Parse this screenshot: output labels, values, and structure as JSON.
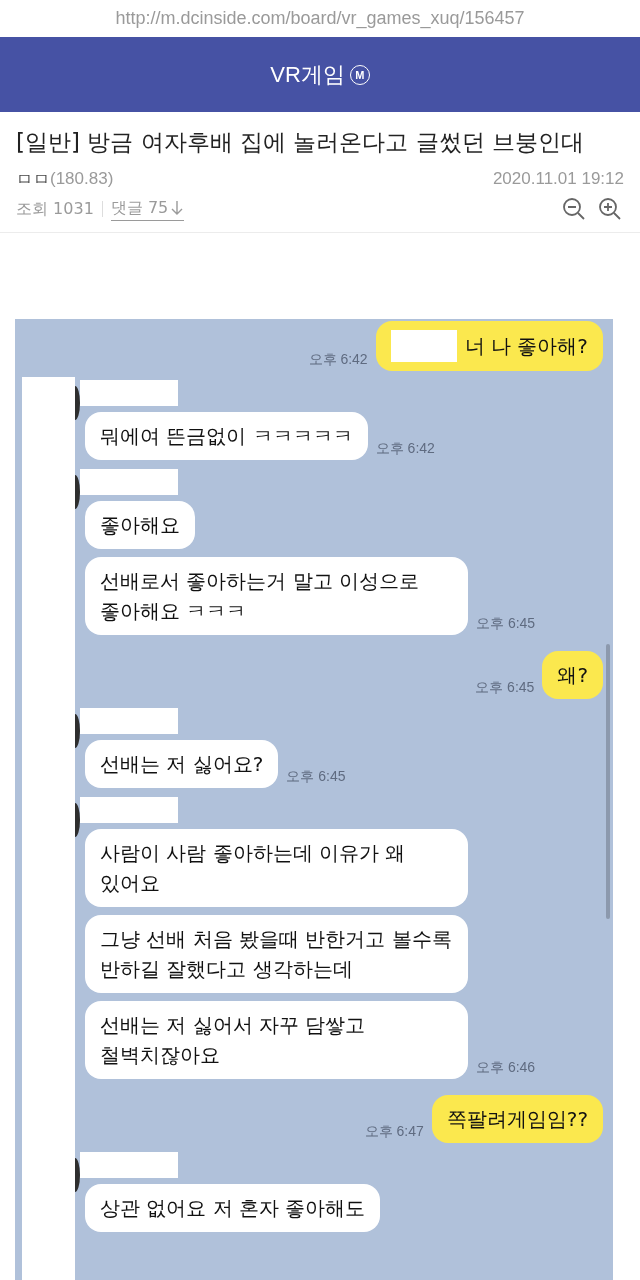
{
  "url_bar": {
    "url": "http://m.dcinside.com/board/vr_games_xuq/156457"
  },
  "header": {
    "title": "VR게임",
    "badge": "M"
  },
  "post": {
    "title": "[일반] 방금 여자후배 집에 놀러온다고 글썼던 브붕인대",
    "author": "ㅁㅁ",
    "author_ip": "(180.83)",
    "date": "2020.11.01 19:12",
    "views": "조회 1031",
    "comments": "댓글 75"
  },
  "chat": {
    "groups": [
      {
        "kind": "sent",
        "messages": [
          {
            "text": "너 나 좋아해?",
            "redacted": true
          }
        ],
        "time": "오후 6:42"
      },
      {
        "kind": "received",
        "messages": [
          {
            "text": "뭐에여 뜬금없이 ㅋㅋㅋㅋㅋ",
            "redacted": false
          }
        ],
        "time": "오후 6:42"
      },
      {
        "kind": "received",
        "messages": [
          {
            "text": "좋아해요",
            "redacted": false
          },
          {
            "text": "선배로서 좋아하는거 말고 이성으로 좋아해요 ㅋㅋㅋ",
            "redacted": false
          }
        ],
        "time": "오후 6:45"
      },
      {
        "kind": "sent",
        "messages": [
          {
            "text": "왜?",
            "redacted": false
          }
        ],
        "time": "오후 6:45"
      },
      {
        "kind": "received",
        "messages": [
          {
            "text": "선배는 저 싫어요?",
            "redacted": false
          }
        ],
        "time": "오후 6:45"
      },
      {
        "kind": "received",
        "messages": [
          {
            "text": "사람이 사람 좋아하는데 이유가 왜 있어요",
            "redacted": false
          },
          {
            "text": "그냥 선배 처음 봤을때 반한거고 볼수록 반하길 잘했다고 생각하는데",
            "redacted": false
          },
          {
            "text": "선배는 저 싫어서 자꾸 담쌓고 철벽치잖아요",
            "redacted": false
          }
        ],
        "time": "오후 6:46"
      },
      {
        "kind": "sent",
        "messages": [
          {
            "text": "쪽팔려게임임??",
            "redacted": false
          }
        ],
        "time": "오후 6:47"
      },
      {
        "kind": "received",
        "messages": [
          {
            "text": "상관 없어요 저 혼자 좋아해도",
            "redacted": false
          }
        ]
      }
    ]
  }
}
